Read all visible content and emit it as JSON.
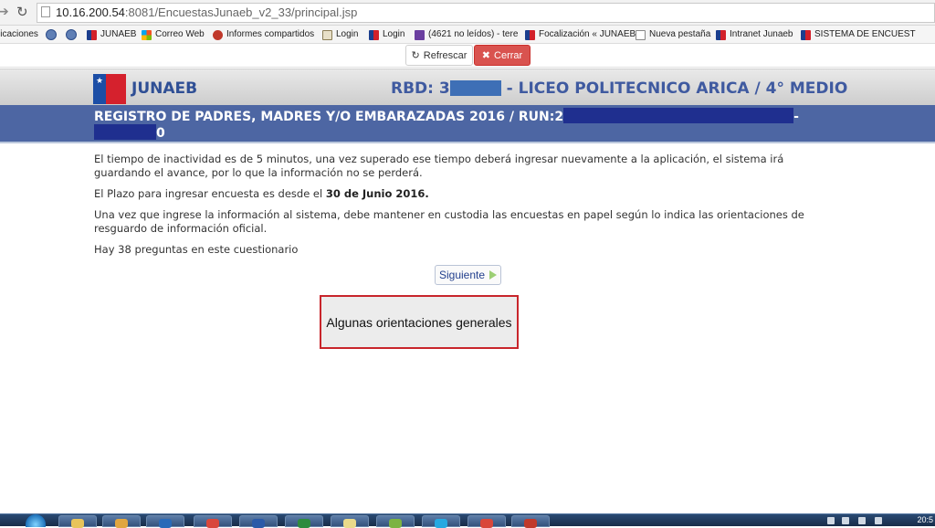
{
  "browser": {
    "url_host": "10.16.200.54",
    "url_path": ":8081/EncuestasJunaeb_v2_33/principal.jsp"
  },
  "bookmarks": [
    {
      "label": "licaciones",
      "icon": "none"
    },
    {
      "label": "",
      "icon": "globe-icon"
    },
    {
      "label": "",
      "icon": "globe-icon"
    },
    {
      "label": "JUNAEB",
      "icon": "chile-flag-icon"
    },
    {
      "label": "Correo Web",
      "icon": "microsoft-icon"
    },
    {
      "label": "Informes compartidos",
      "icon": "red-circle-icon"
    },
    {
      "label": "Login",
      "icon": "login-icon"
    },
    {
      "label": "Login",
      "icon": "chile-flag-icon"
    },
    {
      "label": "(4621 no leídos) - tere",
      "icon": "mail-icon"
    },
    {
      "label": "Focalización « JUNAEB",
      "icon": "chile-flag-icon"
    },
    {
      "label": "Nueva pestaña",
      "icon": "document-icon"
    },
    {
      "label": "Intranet Junaeb",
      "icon": "chile-flag-icon"
    },
    {
      "label": "SISTEMA DE ENCUEST",
      "icon": "chile-flag-icon"
    }
  ],
  "toolbar": {
    "refresh_label": "Refrescar",
    "close_label": "Cerrar",
    "refresh_icon": "refresh-icon",
    "close_icon": "x-icon",
    "close_color": "#d9534f"
  },
  "header": {
    "brand": "JUNAEB",
    "rbd_label": "RBD: 3",
    "school_label": "- LICEO POLITECNICO ARICA / 4° MEDIO",
    "title_line1": "REGISTRO DE PADRES, MADRES Y/O EMBARAZADAS 2016 / RUN:2",
    "title_line1_suffix": "-",
    "title_line2_suffix": "0",
    "brand_color": "#2f4f95",
    "band_color": "#4d66a3"
  },
  "content": {
    "p1": "El tiempo de inactividad es de 5 minutos, una vez superado ese tiempo deberá ingresar nuevamente a la aplicación, el sistema irá guardando el avance, por lo que la información no se perderá.",
    "p2_prefix": "El Plazo para ingresar encuesta es desde  el ",
    "p2_bold": "30 de Junio 2016.",
    "p3": "Una vez que ingrese la información al sistema, debe mantener en custodia las encuestas en papel según lo indica las orientaciones de resguardo de información oficial.",
    "p4": "Hay 38 preguntas en este cuestionario",
    "next_label": "Siguiente",
    "orientation_box": "Algunas orientaciones generales"
  },
  "taskbar": {
    "clock": "20:5",
    "apps": [
      "folder-icon",
      "outlook-icon",
      "chrome-icon",
      "word-icon",
      "excel-icon",
      "notes-icon",
      "explorer-icon",
      "skype-icon",
      "media-icon",
      "acrobat-icon"
    ]
  }
}
